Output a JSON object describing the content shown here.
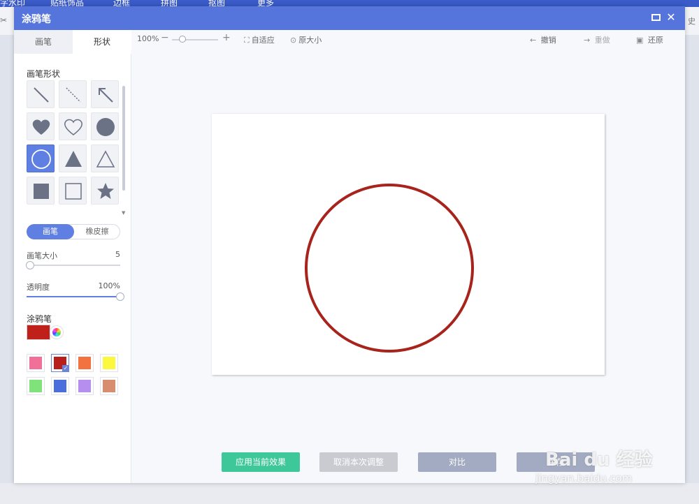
{
  "background_app": {
    "menu_items": [
      "字水印",
      "贴纸饰品",
      "边框",
      "拼图",
      "抠图",
      "更多"
    ],
    "right_partial_text": "史"
  },
  "dialog": {
    "title": "涂鸦笔"
  },
  "left_panel": {
    "tabs": [
      {
        "label": "画笔",
        "active": false
      },
      {
        "label": "形状",
        "active": true
      }
    ],
    "shape_section_label": "画笔形状",
    "shapes": [
      {
        "name": "line",
        "selected": false
      },
      {
        "name": "dashed-line",
        "selected": false
      },
      {
        "name": "arrow",
        "selected": false
      },
      {
        "name": "heart-filled",
        "selected": false
      },
      {
        "name": "heart-outline",
        "selected": false
      },
      {
        "name": "circle-filled",
        "selected": false
      },
      {
        "name": "circle-outline",
        "selected": true
      },
      {
        "name": "triangle-filled",
        "selected": false
      },
      {
        "name": "triangle-outline",
        "selected": false
      },
      {
        "name": "square-filled",
        "selected": false
      },
      {
        "name": "square-outline",
        "selected": false
      },
      {
        "name": "star-filled",
        "selected": false
      }
    ],
    "mode": {
      "brush_label": "画笔",
      "eraser_label": "橡皮擦"
    },
    "brush_size": {
      "label": "画笔大小",
      "value": "5",
      "fraction": 0.04
    },
    "opacity": {
      "label": "透明度",
      "value": "100%",
      "fraction": 1.0
    },
    "color_section_label": "涂鸦笔",
    "current_color": "#c0201a",
    "swatches": [
      {
        "color": "#f0709a",
        "selected": false
      },
      {
        "color": "#b81e1a",
        "selected": true
      },
      {
        "color": "#f27240",
        "selected": false
      },
      {
        "color": "#fbf83f",
        "selected": false
      },
      {
        "color": "#7fe27a",
        "selected": false
      },
      {
        "color": "#4a6edb",
        "selected": false
      },
      {
        "color": "#b58ef0",
        "selected": false
      },
      {
        "color": "#d88e6e",
        "selected": false
      }
    ]
  },
  "toolbar": {
    "zoom_value": "100%",
    "fit_label": "自适应",
    "original_size_label": "原大小",
    "undo_label": "撤销",
    "redo_label": "重做",
    "restore_label": "还原"
  },
  "canvas": {
    "stroke_color": "#a8231c"
  },
  "actions": {
    "apply_label": "应用当前效果",
    "cancel_label": "取消本次调整",
    "compare_label": "对比",
    "save_label": "保存"
  },
  "watermark": {
    "brand": "Bai du 经验",
    "url": "jingyan.baidu.com"
  },
  "colors": {
    "accent": "#5575dc",
    "apply_green": "#3ec798"
  }
}
